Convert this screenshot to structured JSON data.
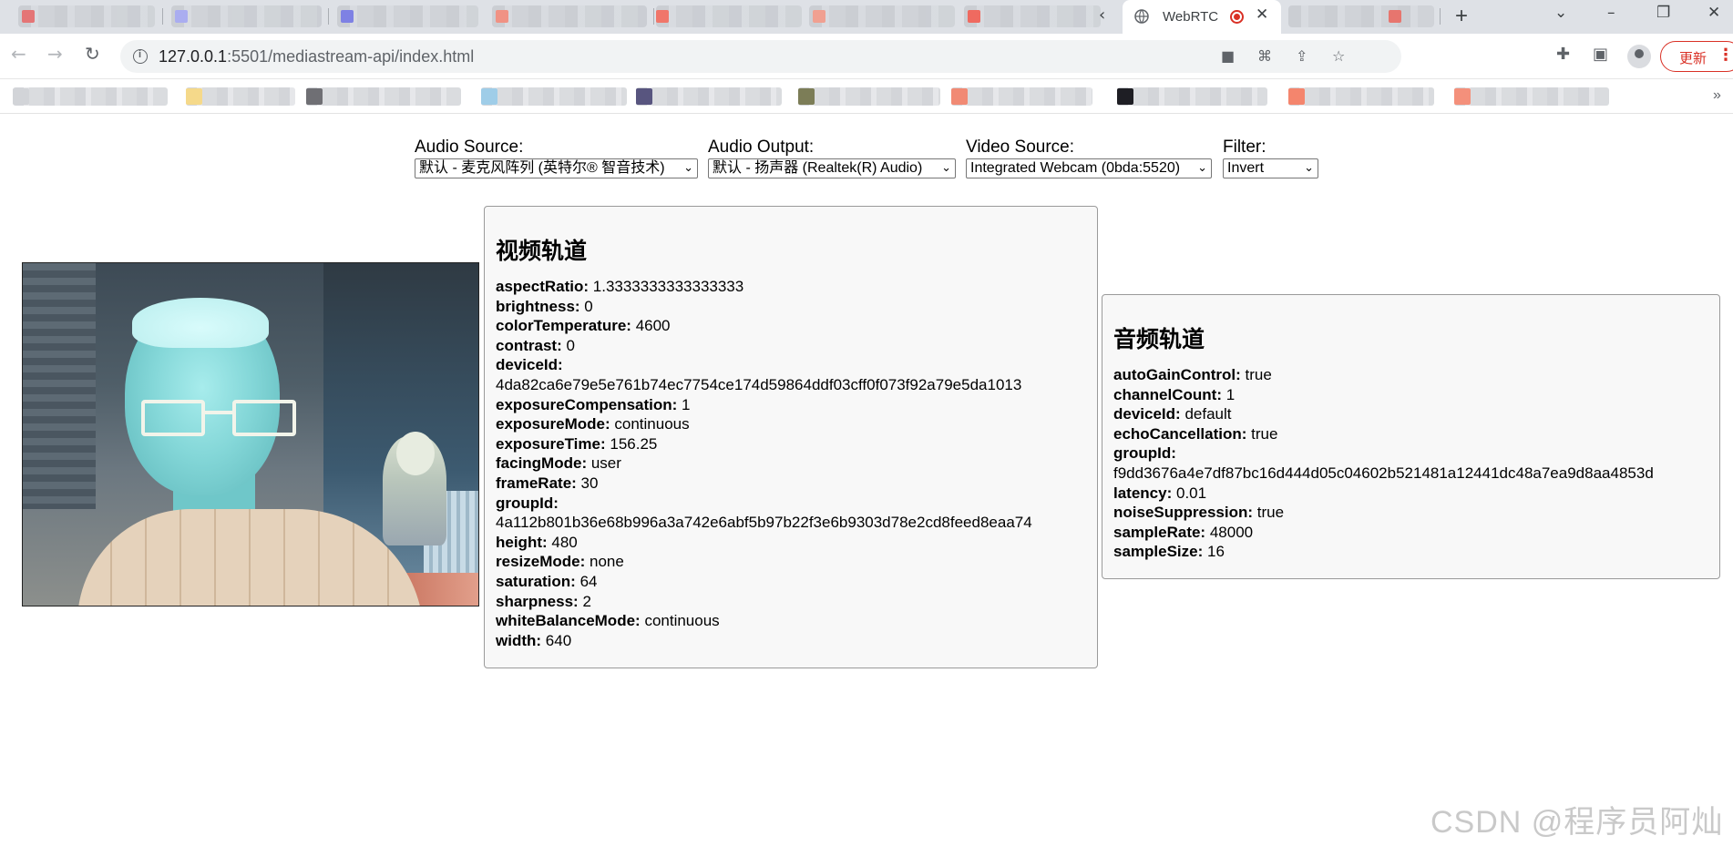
{
  "browser": {
    "active_tab_title": "WebRTC",
    "new_tab_symbol": "+",
    "url_host": "127.0.0.1",
    "url_rest": ":5501/mediastream-api/index.html",
    "update_label": "更新",
    "colors": {
      "accent": "#d93025",
      "tabstrip": "#dee1e6"
    },
    "icons": [
      "back-arrow-icon",
      "forward-arrow-icon",
      "reload-icon",
      "site-info-icon",
      "camera-icon",
      "translate-icon",
      "share-icon",
      "star-icon",
      "extensions-icon",
      "sidepanel-icon",
      "profile-icon",
      "menu-dots-icon"
    ]
  },
  "controls": {
    "audio_source": {
      "label": "Audio Source:",
      "value": "默认 - 麦克风阵列 (英特尔® 智音技术)"
    },
    "audio_output": {
      "label": "Audio Output:",
      "value": "默认 - 扬声器 (Realtek(R) Audio)"
    },
    "video_source": {
      "label": "Video Source:",
      "value": "Integrated Webcam (0bda:5520)"
    },
    "filter": {
      "label": "Filter:",
      "value": "Invert"
    }
  },
  "video_track": {
    "title": "视频轨道",
    "props": [
      {
        "key": "aspectRatio:",
        "value": "1.3333333333333333"
      },
      {
        "key": "brightness:",
        "value": "0"
      },
      {
        "key": "colorTemperature:",
        "value": "4600"
      },
      {
        "key": "contrast:",
        "value": "0"
      },
      {
        "key": "deviceId:",
        "value": "4da82ca6e79e5e761b74ec7754ce174d59864ddf03cff0f073f92a79e5da1013",
        "wrap": true
      },
      {
        "key": "exposureCompensation:",
        "value": "1"
      },
      {
        "key": "exposureMode:",
        "value": "continuous"
      },
      {
        "key": "exposureTime:",
        "value": "156.25"
      },
      {
        "key": "facingMode:",
        "value": "user"
      },
      {
        "key": "frameRate:",
        "value": "30"
      },
      {
        "key": "groupId:",
        "value": "4a112b801b36e68b996a3a742e6abf5b97b22f3e6b9303d78e2cd8feed8eaa74",
        "wrap": true
      },
      {
        "key": "height:",
        "value": "480"
      },
      {
        "key": "resizeMode:",
        "value": "none"
      },
      {
        "key": "saturation:",
        "value": "64"
      },
      {
        "key": "sharpness:",
        "value": "2"
      },
      {
        "key": "whiteBalanceMode:",
        "value": "continuous"
      },
      {
        "key": "width:",
        "value": "640"
      }
    ]
  },
  "audio_track": {
    "title": "音频轨道",
    "props": [
      {
        "key": "autoGainControl:",
        "value": "true"
      },
      {
        "key": "channelCount:",
        "value": "1"
      },
      {
        "key": "deviceId:",
        "value": "default"
      },
      {
        "key": "echoCancellation:",
        "value": "true"
      },
      {
        "key": "groupId:",
        "value": "f9dd3676a4e7df87bc16d444d05c04602b521481a12441dc48a7ea9d8aa4853d",
        "wrap": true
      },
      {
        "key": "latency:",
        "value": "0.01"
      },
      {
        "key": "noiseSuppression:",
        "value": "true"
      },
      {
        "key": "sampleRate:",
        "value": "48000"
      },
      {
        "key": "sampleSize:",
        "value": "16"
      }
    ]
  },
  "watermark": "CSDN @程序员阿灿"
}
